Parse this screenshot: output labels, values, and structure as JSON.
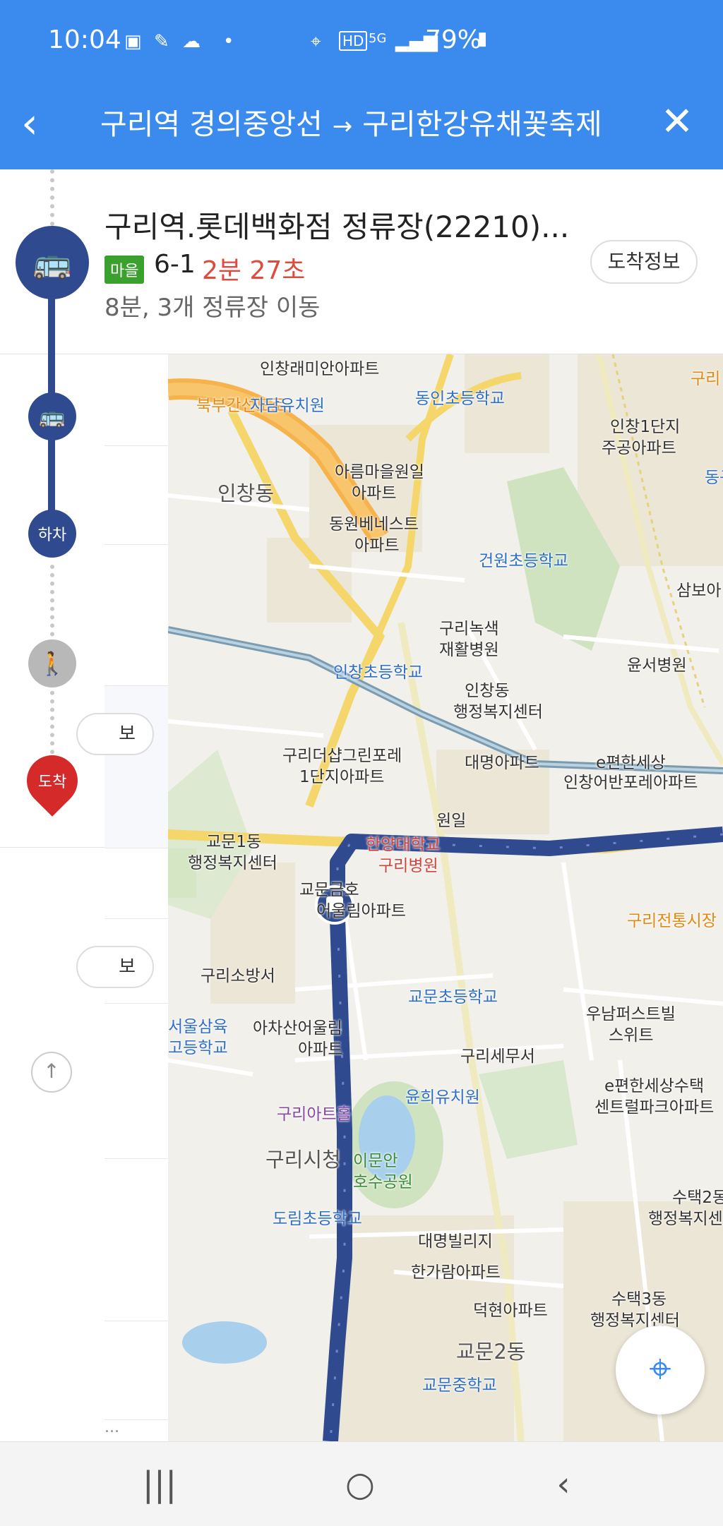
{
  "status_bar": {
    "time": "10:04",
    "battery": "79%",
    "icons": [
      "gallery-icon",
      "feather-icon",
      "cloud-icon",
      "dot-icon",
      "location-icon",
      "hd-icon",
      "5g-icon",
      "signal-icon",
      "battery-icon"
    ]
  },
  "header": {
    "origin": "구리역 경의중앙선",
    "arrow": "→",
    "destination": "구리한강유채꽃축제",
    "back_icon": "‹",
    "close_icon": "✕"
  },
  "current_step": {
    "stop_name": "구리역.롯데백화점 정류장(22210)...",
    "badge": "마을",
    "route": "6-1",
    "eta": "2분 27초",
    "summary": "8분, 3개 정류장 이동",
    "arrival_button": "도착정보"
  },
  "timeline": {
    "alight_label": "하차",
    "arrive_label": "도착"
  },
  "strip": {
    "pill1": "보",
    "pill2": "보",
    "bottom": "..."
  },
  "map": {
    "labels": [
      {
        "text": "인창래미안아파트",
        "cls": ""
      },
      {
        "text": "동인초등학교",
        "cls": "school"
      },
      {
        "text": "북부간선도로",
        "cls": "orange"
      },
      {
        "text": "자담유치원",
        "cls": "school"
      },
      {
        "text": "인창1단지",
        "cls": ""
      },
      {
        "text": "주공아파트",
        "cls": ""
      },
      {
        "text": "아름마을원일",
        "cls": ""
      },
      {
        "text": "아파트",
        "cls": ""
      },
      {
        "text": "인창동",
        "cls": "area"
      },
      {
        "text": "동원베네스트",
        "cls": ""
      },
      {
        "text": "아파트",
        "cls": ""
      },
      {
        "text": "건원초등학교",
        "cls": "school"
      },
      {
        "text": "삼보아",
        "cls": ""
      },
      {
        "text": "구리녹색",
        "cls": ""
      },
      {
        "text": "재활병원",
        "cls": ""
      },
      {
        "text": "윤서병원",
        "cls": ""
      },
      {
        "text": "인창초등학교",
        "cls": "school"
      },
      {
        "text": "인창동",
        "cls": ""
      },
      {
        "text": "행정복지센터",
        "cls": ""
      },
      {
        "text": "구리더샵그린포레",
        "cls": ""
      },
      {
        "text": "1단지아파트",
        "cls": ""
      },
      {
        "text": "대명아파트",
        "cls": ""
      },
      {
        "text": "e편한세상",
        "cls": ""
      },
      {
        "text": "인창어반포레아파트",
        "cls": ""
      },
      {
        "text": "원일",
        "cls": ""
      },
      {
        "text": "교문1동",
        "cls": ""
      },
      {
        "text": "행정복지센터",
        "cls": ""
      },
      {
        "text": "한양대학교",
        "cls": "red"
      },
      {
        "text": "구리병원",
        "cls": "red"
      },
      {
        "text": "교문금호",
        "cls": ""
      },
      {
        "text": "어울림아파트",
        "cls": ""
      },
      {
        "text": "구리전통시장",
        "cls": "orange"
      },
      {
        "text": "구리소방서",
        "cls": ""
      },
      {
        "text": "교문초등학교",
        "cls": "school"
      },
      {
        "text": "우남퍼스트빌",
        "cls": ""
      },
      {
        "text": "스위트",
        "cls": ""
      },
      {
        "text": "서울삼육",
        "cls": "school"
      },
      {
        "text": "고등학교",
        "cls": "school"
      },
      {
        "text": "아차산어울림",
        "cls": ""
      },
      {
        "text": "아파트",
        "cls": ""
      },
      {
        "text": "구리세무서",
        "cls": ""
      },
      {
        "text": "e편한세상수택",
        "cls": ""
      },
      {
        "text": "센트럴파크아파트",
        "cls": ""
      },
      {
        "text": "윤희유치원",
        "cls": "school"
      },
      {
        "text": "구리아트홀",
        "cls": "purple"
      },
      {
        "text": "구리시청",
        "cls": "area"
      },
      {
        "text": "이문안",
        "cls": "green"
      },
      {
        "text": "호수공원",
        "cls": "green"
      },
      {
        "text": "도림초등학교",
        "cls": "school"
      },
      {
        "text": "수택2동",
        "cls": ""
      },
      {
        "text": "행정복지센",
        "cls": ""
      },
      {
        "text": "대명빌리지",
        "cls": ""
      },
      {
        "text": "한가람아파트",
        "cls": ""
      },
      {
        "text": "수택3동",
        "cls": ""
      },
      {
        "text": "행정복지센터",
        "cls": ""
      },
      {
        "text": "덕현아파트",
        "cls": ""
      },
      {
        "text": "교문2동",
        "cls": "area"
      },
      {
        "text": "교문중학교",
        "cls": "school"
      },
      {
        "text": "동구",
        "cls": "school"
      },
      {
        "text": "구리",
        "cls": "orange"
      }
    ]
  },
  "colors": {
    "primary": "#3b8bef",
    "route": "#2f4a8e",
    "eta": "#e04a3c",
    "badge": "#3aa12f",
    "arrive_pin": "#d42a2a"
  },
  "navbar": {
    "recent": "|||",
    "home": "○",
    "back": "‹"
  }
}
